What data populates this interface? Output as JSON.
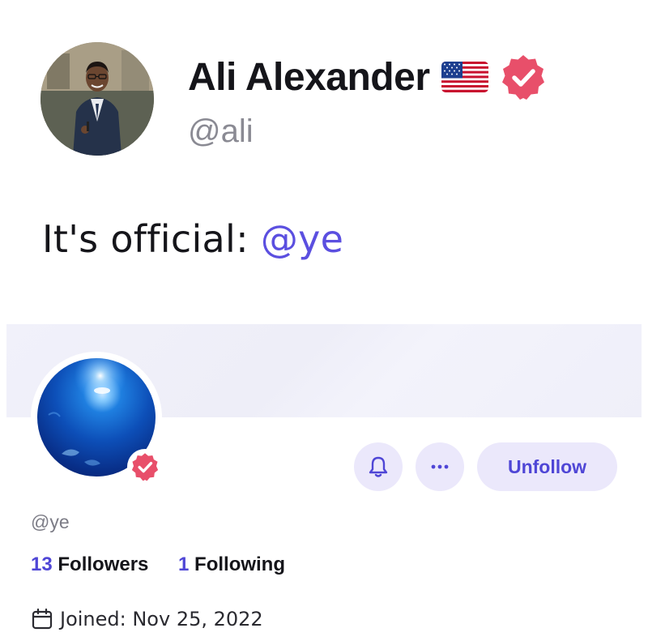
{
  "post": {
    "author": {
      "name": "Ali Alexander",
      "handle": "@ali",
      "flag_icon": "us-flag-icon",
      "verified_icon": "verified-badge-icon"
    },
    "text": "It's official: ",
    "mention": "@ye"
  },
  "profile_card": {
    "handle": "@ye",
    "verified_icon": "verified-badge-icon",
    "actions": {
      "bell_icon": "bell-icon",
      "more_icon": "more-dots-icon",
      "unfollow_label": "Unfollow"
    },
    "stats": {
      "followers_count": "13",
      "followers_label": "Followers",
      "following_count": "1",
      "following_label": "Following"
    },
    "joined": {
      "icon": "calendar-icon",
      "text": "Joined: Nov 25, 2022"
    }
  },
  "colors": {
    "accent": "#4f46d6",
    "mention": "#5b4fe0",
    "verified": "#e84f6a",
    "button_bg": "#ebe8fb",
    "banner": "#f0f0f9",
    "muted_text": "#8a8a93"
  }
}
